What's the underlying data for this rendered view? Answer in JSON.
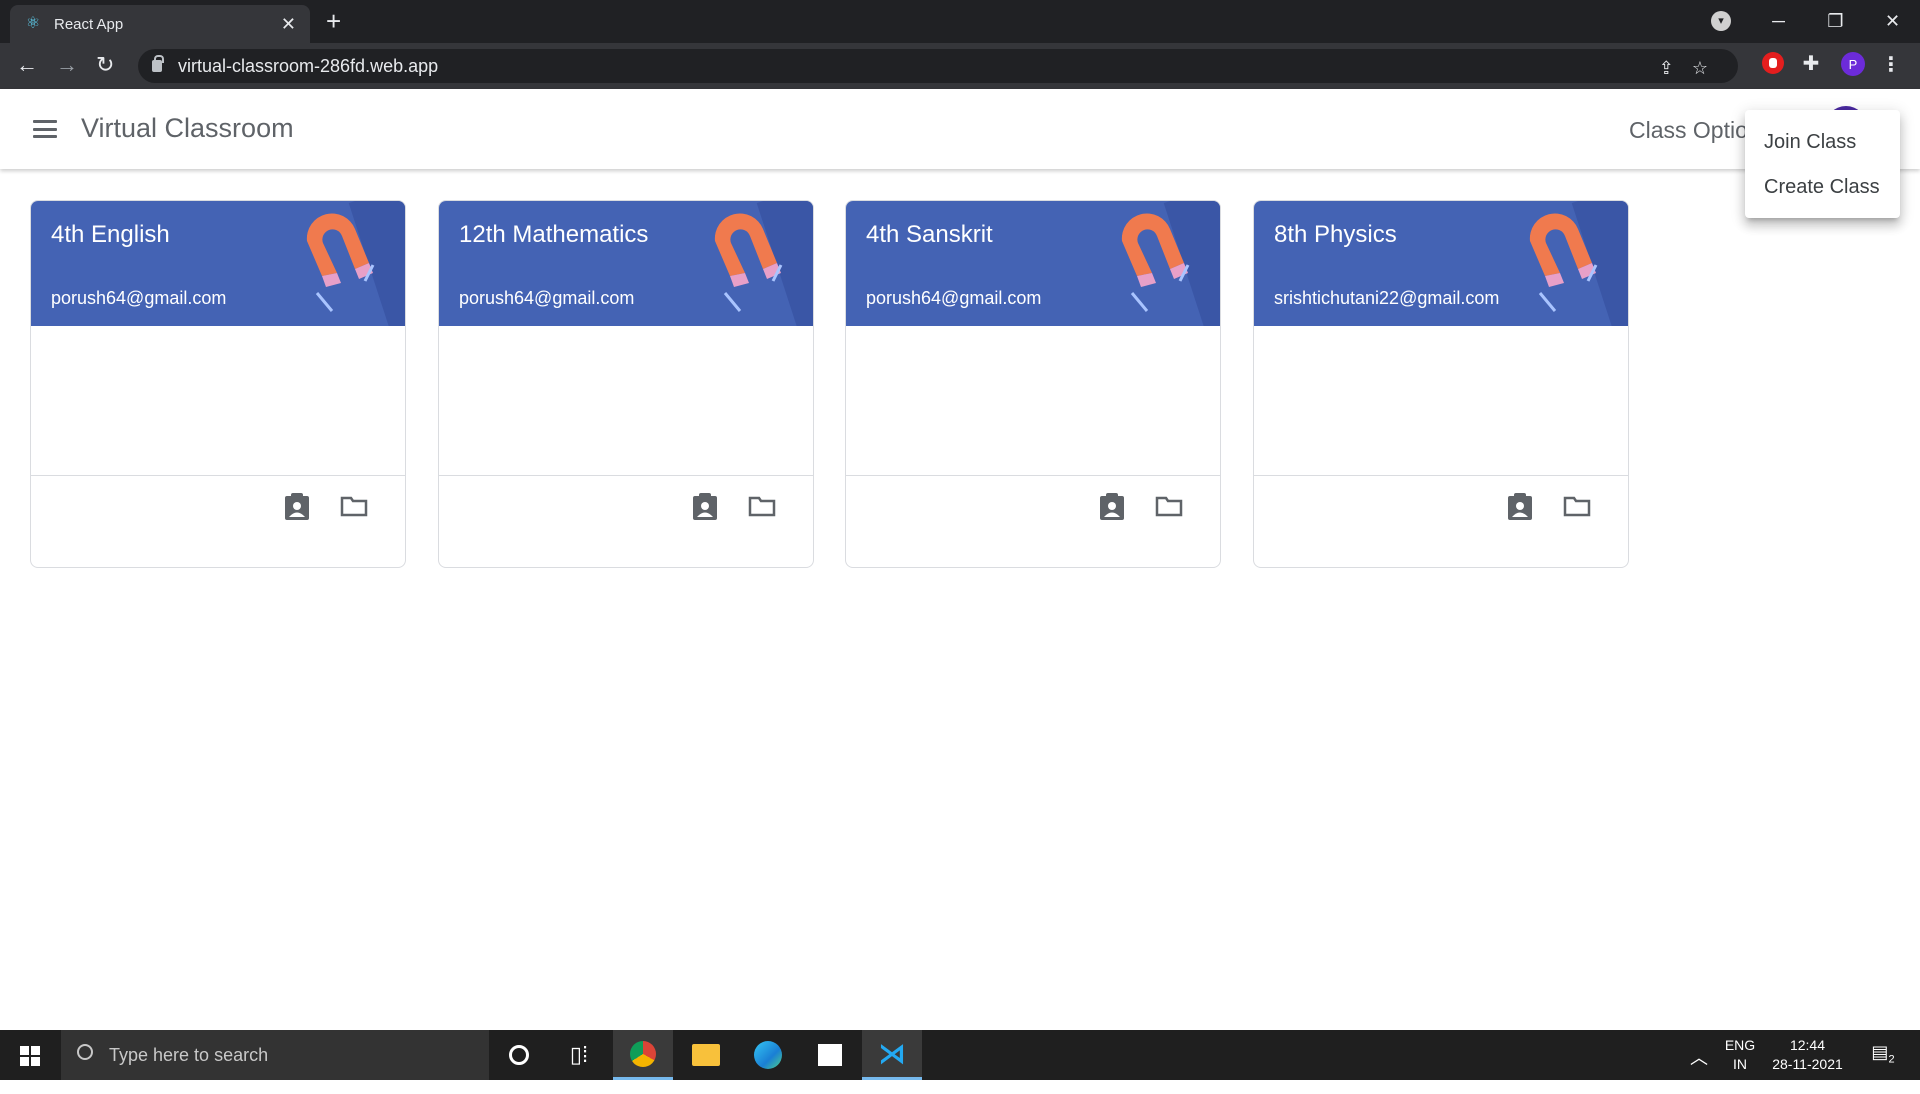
{
  "browser": {
    "tab_title": "React App",
    "url": "virtual-classroom-286fd.web.app",
    "profile_initial": "P",
    "new_tab_symbol": "+",
    "close_symbol": "✕"
  },
  "app": {
    "title": "Virtual Classroom",
    "class_options_label": "Class Optio",
    "menu": [
      "Join Class",
      "Create Class"
    ]
  },
  "classes": [
    {
      "name": "4th English",
      "owner": "porush64@gmail.com"
    },
    {
      "name": "12th Mathematics",
      "owner": "porush64@gmail.com"
    },
    {
      "name": "4th Sanskrit",
      "owner": "porush64@gmail.com"
    },
    {
      "name": "8th Physics",
      "owner": "srishtichutani22@gmail.com"
    }
  ],
  "colors": {
    "card_header": "#4463b4",
    "accent": "#4a2aa0"
  },
  "taskbar": {
    "search_placeholder": "Type here to search",
    "lang_top": "ENG",
    "lang_bottom": "IN",
    "time": "12:44",
    "date": "28-11-2021",
    "notification_count": "2"
  }
}
